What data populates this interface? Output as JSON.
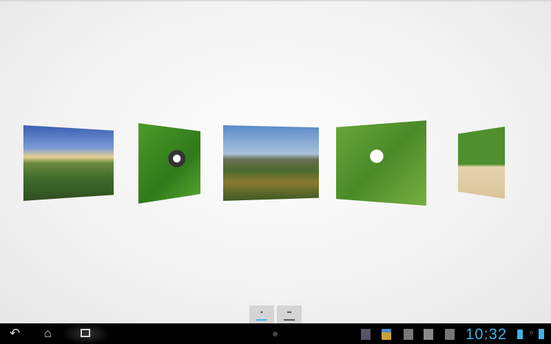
{
  "gallery": {
    "photos": [
      {
        "name": "golf-course-mountains"
      },
      {
        "name": "ball-in-hole"
      },
      {
        "name": "valley-landscape"
      },
      {
        "name": "driver-and-ball-on-tee"
      },
      {
        "name": "golfer-in-bunker"
      }
    ]
  },
  "pager": {
    "buttons": [
      {
        "label": "•",
        "active": true
      },
      {
        "label": "••",
        "active": false
      }
    ]
  },
  "colors": {
    "accent": "#3fb4e6"
  },
  "status_bar": {
    "time": "10:32",
    "nav_icons": [
      "back-icon",
      "home-icon",
      "recent-apps-icon"
    ],
    "notification_icons": [
      "screenshot-icon",
      "cleaner-icon",
      "sd-card-icon",
      "download-icon",
      "sd-card-icon"
    ]
  }
}
